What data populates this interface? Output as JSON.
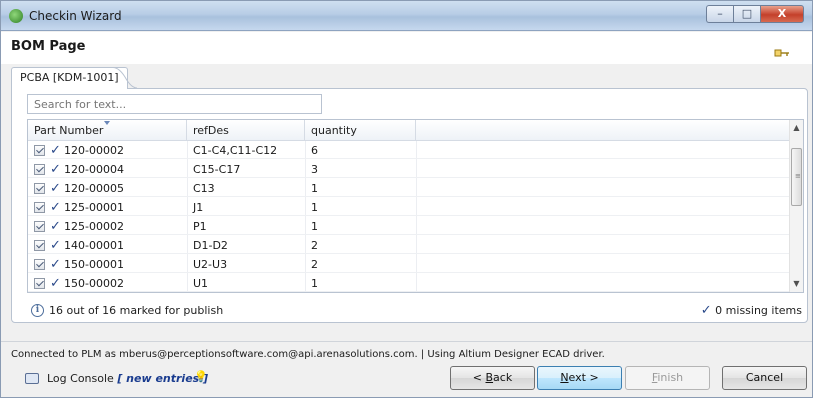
{
  "window": {
    "title": "Checkin Wizard",
    "controls": {
      "minimize": "–",
      "maximize": "□",
      "close": "X"
    }
  },
  "header": {
    "page_title": "BOM Page"
  },
  "tab": {
    "label": "PCBA [KDM-1001]"
  },
  "search": {
    "placeholder": "Search for text..."
  },
  "table": {
    "columns": [
      "Part Number",
      "refDes",
      "quantity"
    ],
    "rows": [
      {
        "checked": true,
        "part_number": "120-00002",
        "ref_des": "C1-C4,C11-C12",
        "quantity": "6"
      },
      {
        "checked": true,
        "part_number": "120-00004",
        "ref_des": "C15-C17",
        "quantity": "3"
      },
      {
        "checked": true,
        "part_number": "120-00005",
        "ref_des": "C13",
        "quantity": "1"
      },
      {
        "checked": true,
        "part_number": "125-00001",
        "ref_des": "J1",
        "quantity": "1"
      },
      {
        "checked": true,
        "part_number": "125-00002",
        "ref_des": "P1",
        "quantity": "1"
      },
      {
        "checked": true,
        "part_number": "140-00001",
        "ref_des": "D1-D2",
        "quantity": "2"
      },
      {
        "checked": true,
        "part_number": "150-00001",
        "ref_des": "U2-U3",
        "quantity": "2"
      },
      {
        "checked": true,
        "part_number": "150-00002",
        "ref_des": "U1",
        "quantity": "1"
      }
    ]
  },
  "status": {
    "marked": "16 out of 16 marked for publish",
    "missing": "0 missing items"
  },
  "footer": {
    "connected": "Connected to PLM as mberus@perceptionsoftware.com@api.arenasolutions.com.  | Using Altium Designer ECAD driver.",
    "console_label": "Log Console",
    "console_entries": "[ new entries ]"
  },
  "buttons": {
    "back_prefix": "< ",
    "back_mnemonic": "B",
    "back_rest": "ack",
    "next_mnemonic": "N",
    "next_rest": "ext >",
    "finish_mnemonic": "F",
    "finish_rest": "inish",
    "cancel": "Cancel"
  },
  "colors": {
    "accent": "#2b4a8a",
    "primary_button": "#bee6fd"
  }
}
